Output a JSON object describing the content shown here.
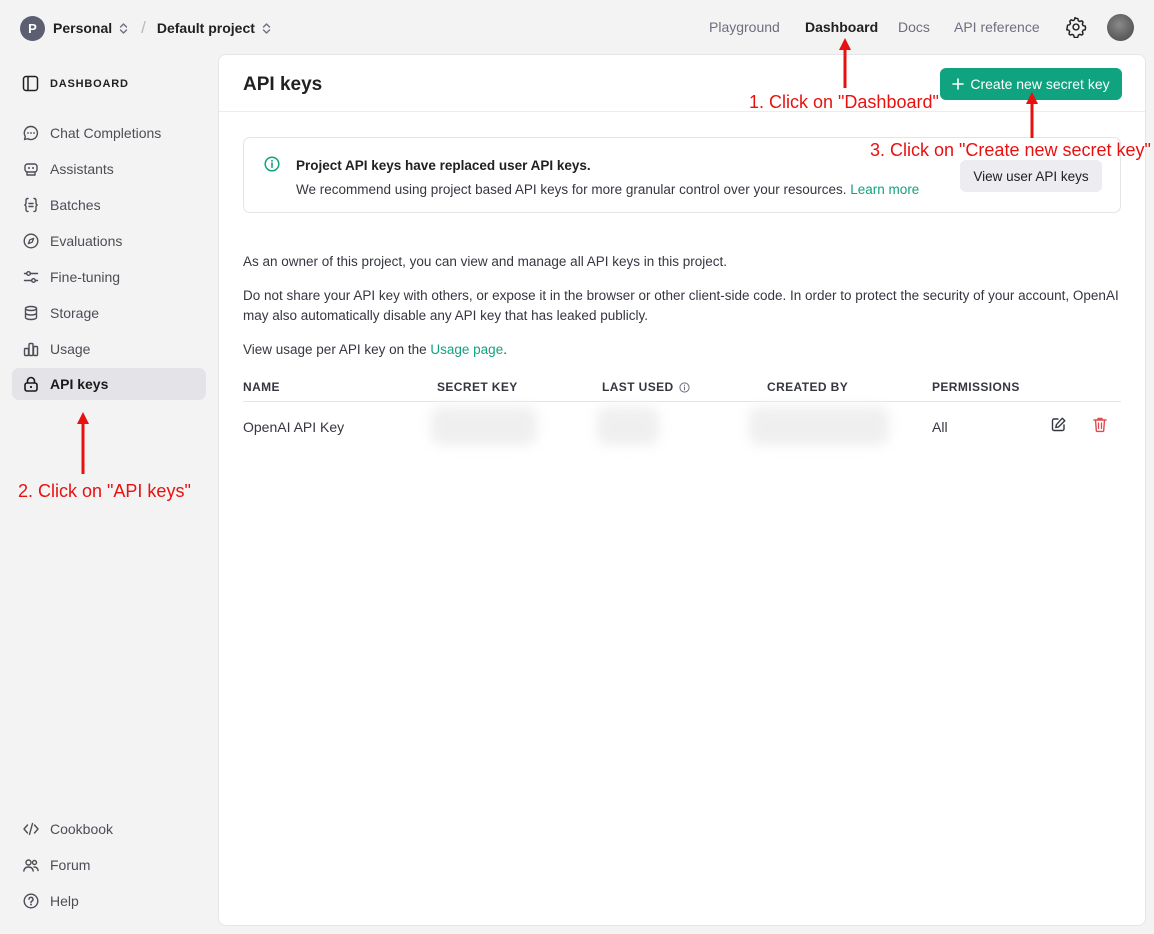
{
  "header": {
    "org_initial": "P",
    "org_name": "Personal",
    "separator": "/",
    "project_name": "Default project",
    "nav": [
      "Playground",
      "Dashboard",
      "Docs",
      "API reference"
    ],
    "active_nav": "Dashboard"
  },
  "sidebar": {
    "heading": "DASHBOARD",
    "items": [
      {
        "label": "Chat Completions",
        "icon": "chat-icon"
      },
      {
        "label": "Assistants",
        "icon": "robot-icon"
      },
      {
        "label": "Batches",
        "icon": "braces-icon"
      },
      {
        "label": "Evaluations",
        "icon": "compass-icon"
      },
      {
        "label": "Fine-tuning",
        "icon": "sliders-icon"
      },
      {
        "label": "Storage",
        "icon": "database-icon"
      },
      {
        "label": "Usage",
        "icon": "bar-chart-icon"
      },
      {
        "label": "API keys",
        "icon": "lock-icon",
        "active": true
      }
    ],
    "footer_items": [
      {
        "label": "Cookbook",
        "icon": "code-icon"
      },
      {
        "label": "Forum",
        "icon": "people-icon"
      },
      {
        "label": "Help",
        "icon": "help-icon"
      }
    ]
  },
  "main": {
    "title": "API keys",
    "create_button": "Create new secret key",
    "banner": {
      "title": "Project API keys have replaced user API keys.",
      "text": "We recommend using project based API keys for more granular control over your resources.",
      "link": "Learn more",
      "button": "View user API keys"
    },
    "para1": "As an owner of this project, you can view and manage all API keys in this project.",
    "para2": "Do not share your API key with others, or expose it in the browser or other client-side code. In order to protect the security of your account, OpenAI may also automatically disable any API key that has leaked publicly.",
    "para3_prefix": "View usage per API key on the",
    "para3_link": "Usage page",
    "para3_suffix": ".",
    "table": {
      "columns": [
        "NAME",
        "SECRET KEY",
        "LAST USED",
        "CREATED BY",
        "PERMISSIONS"
      ],
      "rows": [
        {
          "name": "OpenAI API Key",
          "permissions": "All"
        }
      ]
    }
  },
  "annotations": {
    "step1": "1. Click on \"Dashboard\"",
    "step2": "2. Click on \"API keys\"",
    "step3": "3. Click on \"Create new secret key\""
  },
  "colors": {
    "accent": "#10a37f",
    "annotation": "#e8110f",
    "danger": "#e5484d"
  }
}
